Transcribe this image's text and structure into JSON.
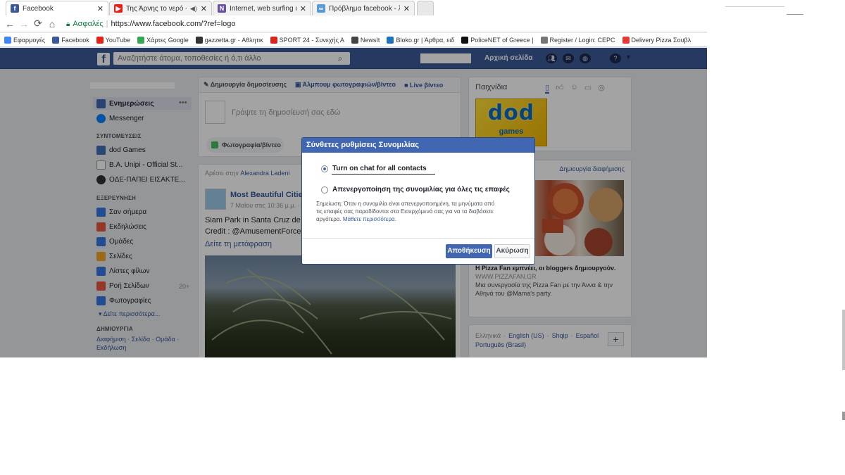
{
  "tabs": [
    {
      "title": "Facebook",
      "icon": "facebook-icon",
      "color": "#3b5998",
      "glyph": "f"
    },
    {
      "title": "Της Άρνης το νερό -",
      "icon": "youtube-icon",
      "color": "#e62117",
      "glyph": "▶"
    },
    {
      "title": "Internet, web surfing και",
      "icon": "site-icon",
      "color": "#6b4fa0",
      "glyph": "N"
    },
    {
      "title": "Πρόβλημα facebook - λα",
      "icon": "forum-icon",
      "color": "#5a9bd4",
      "glyph": "∞"
    }
  ],
  "address": {
    "secure_label": "Ασφαλές",
    "url": "https://www.facebook.com/?ref=logo"
  },
  "bookmarks": [
    {
      "label": "Εφαρμογές",
      "color": "#4285f4"
    },
    {
      "label": "Facebook",
      "color": "#3b5998"
    },
    {
      "label": "YouTube",
      "color": "#e62117"
    },
    {
      "label": "Χάρτες Google",
      "color": "#34a853"
    },
    {
      "label": "gazzetta.gr - Αθλητικ",
      "color": "#333333"
    },
    {
      "label": "SPORT 24 - Συνεχής Α",
      "color": "#d9261c"
    },
    {
      "label": "NewsIt",
      "color": "#444444"
    },
    {
      "label": "Bloko.gr | Άρθρα, ειδ",
      "color": "#1e73be"
    },
    {
      "label": "PoliceNET of Greece |",
      "color": "#111111"
    },
    {
      "label": "Register / Login: CEPC",
      "color": "#777777"
    },
    {
      "label": "Delivery Pizza Σουβλ",
      "color": "#e53935"
    }
  ],
  "fb": {
    "search_placeholder": "Αναζητήστε άτομα, τοποθεσίες ή ό,τι άλλο",
    "home_label": "Αρχική σελίδα"
  },
  "left_nav": {
    "news": "Ενημερώσεις",
    "messenger": "Messenger",
    "shortcuts_head": "ΣΥΝΤΟΜΕΥΣΕΙΣ",
    "shortcuts": [
      "dod Games",
      "B.A. Unipi - Official St...",
      "ΟΔΕ-ΠΑΠΕΙ ΕΙΣΑΚΤΕ..."
    ],
    "explore_head": "ΕΞΕΡΕΥΝΗΣΗ",
    "explore": [
      "Σαν σήμερα",
      "Εκδηλώσεις",
      "Ομάδες",
      "Σελίδες",
      "Λίστες φίλων",
      "Ροή Σελίδων",
      "Φωτογραφίες"
    ],
    "explore_badge": "20+",
    "see_more": "Δείτε περισσότερα...",
    "create_head": "ΔΗΜΙΟΥΡΓΙΑ",
    "create_links": "Διαφήμιση · Σελίδα · Ομάδα ·",
    "create_event": "Εκδήλωση"
  },
  "composer": {
    "tab_post": "Δημιουργία δημοσίευσης",
    "tab_album": "Άλμπουμ φωτογραφιών/βίντεο",
    "tab_live": "Live βίντεο",
    "placeholder": "Γράψτε τη δημοσίευσή σας εδώ",
    "photo_btn": "Φωτογραφία/βίντεο"
  },
  "feed": {
    "liked_by_prefix": "Αρέσει στην",
    "liked_by_name": "Alexandra Ladeni",
    "page_name": "Most Beautiful Citie",
    "post_time": "7 Μαΐου στις 10:36 μ.μ. ·",
    "text_line1": "Siam Park in Santa Cruz de T",
    "text_line2": "Credit : @AmusementForce",
    "translate": "Δείτε τη μετάφραση"
  },
  "right": {
    "games_title": "Παιχνίδια",
    "games_logo": "dod",
    "games_sub": "games",
    "create_ad": "Δημιουργία διαφήμισης",
    "ad_title": "Η Pizza Fan εμπνέει, οι bloggers δημιουργούν.",
    "ad_url": "WWW.PIZZAFAN.GR",
    "ad_text1": "Μια συνεργασία της Pizza Fan με την Άννα & την",
    "ad_text2": "Αθηνά του @Mama's party.",
    "languages1": [
      "Ελληνικά",
      "English (US)",
      "Shqip",
      "Español"
    ],
    "languages2": "Português (Brasil)"
  },
  "modal": {
    "title": "Σύνθετες ρυθμίσεις Συνομιλίας",
    "option1": "Turn on chat for all contacts",
    "option2": "Απενεργοποίηση της συνομιλίας για όλες τις επαφές",
    "note_line1": "Σημείωση: Όταν η συνομιλία είναι απενεργοποιημένη, τα μηνύματα από",
    "note_line2": "τις επαφές σας παραδίδονται στα Εισερχόμενά σας για να τα διαβάσετε",
    "note_line3_prefix": "αργότερα.",
    "note_link": "Μάθετε περισσότερα.",
    "save": "Αποθήκευση",
    "cancel": "Ακύρωση",
    "selected_option": 1
  },
  "colors": {
    "fb_blue": "#3b5998",
    "button_blue": "#4267b2",
    "link": "#365899"
  }
}
